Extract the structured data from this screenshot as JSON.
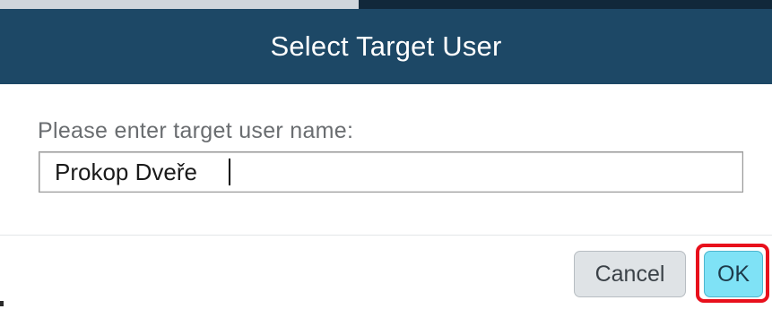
{
  "dialog": {
    "title": "Select Target User",
    "prompt": "Please enter target user name:",
    "input_value": "Prokop Dveře",
    "cancel_label": "Cancel",
    "ok_label": "OK"
  },
  "colors": {
    "header_bg": "#1d4866",
    "header_text": "#ffffff",
    "ok_button_bg": "#7fe2f6",
    "cancel_button_bg": "#dfe3e6",
    "highlight_border": "#e8101c"
  }
}
